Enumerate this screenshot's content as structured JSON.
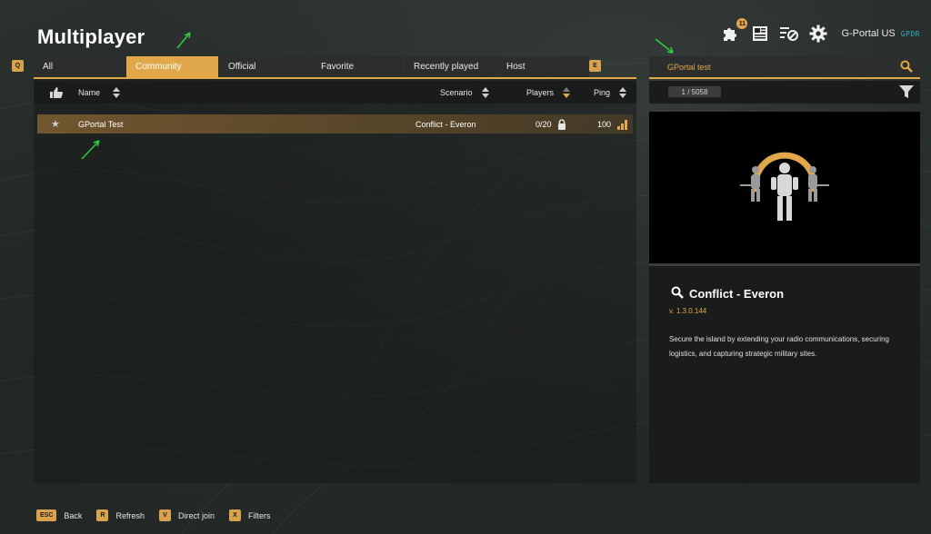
{
  "title": "Multiplayer",
  "key_hints": {
    "prev_tab": "Q",
    "next_tab": "E"
  },
  "tabs": [
    "All",
    "Community",
    "Official",
    "Favorite",
    "Recently played",
    "Host"
  ],
  "active_tab": "Community",
  "header_icons": [
    "puzzle-icon",
    "news-icon",
    "filter-settings-icon",
    "gear-icon"
  ],
  "notification_count": "11",
  "user": {
    "name": "G-Portal US",
    "brand": "GPDR"
  },
  "columns": {
    "name": "Name",
    "scenario": "Scenario",
    "players": "Players",
    "ping": "Ping"
  },
  "servers": [
    {
      "name": "GPortal Test",
      "scenario": "Conflict - Everon",
      "players": "0/20",
      "ping": "100",
      "favorite": false,
      "locked": true
    }
  ],
  "search": {
    "value": "GPortal test"
  },
  "result_count": "1 / 5058",
  "details": {
    "title": "Conflict - Everon",
    "version": "v. 1.3.0.144",
    "description": "Secure the island by extending your radio communications, securing logistics, and capturing strategic military sites."
  },
  "footer": [
    {
      "key": "ESC",
      "label": "Back"
    },
    {
      "key": "R",
      "label": "Refresh"
    },
    {
      "key": "V",
      "label": "Direct join"
    },
    {
      "key": "X",
      "label": "Filters"
    }
  ],
  "colors": {
    "accent": "#e0a84a",
    "panel": "#1a1c1c",
    "tab": "#2b2e2d",
    "annotation": "#2ecc40"
  }
}
